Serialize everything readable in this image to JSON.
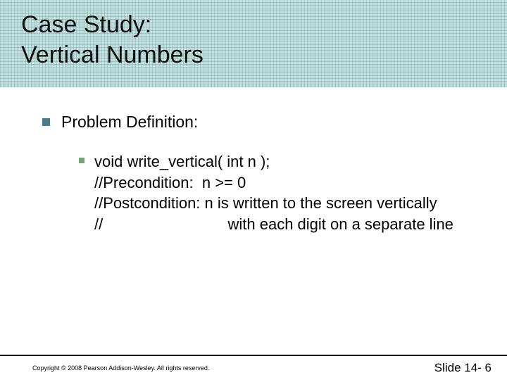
{
  "title_line1": "Case Study:",
  "title_line2": "Vertical Numbers",
  "body": {
    "heading": "Problem Definition:",
    "code": {
      "l1": "void write_vertical( int n );",
      "l2": "//Precondition:  n >= 0",
      "l3": "//Postcondition: n is written to the screen vertically",
      "l4": "//                             with each digit on a separate line"
    }
  },
  "footer": {
    "copyright": "Copyright © 2008 Pearson Addison-Wesley.  All rights reserved.",
    "slide_number": "Slide 14- 6"
  }
}
